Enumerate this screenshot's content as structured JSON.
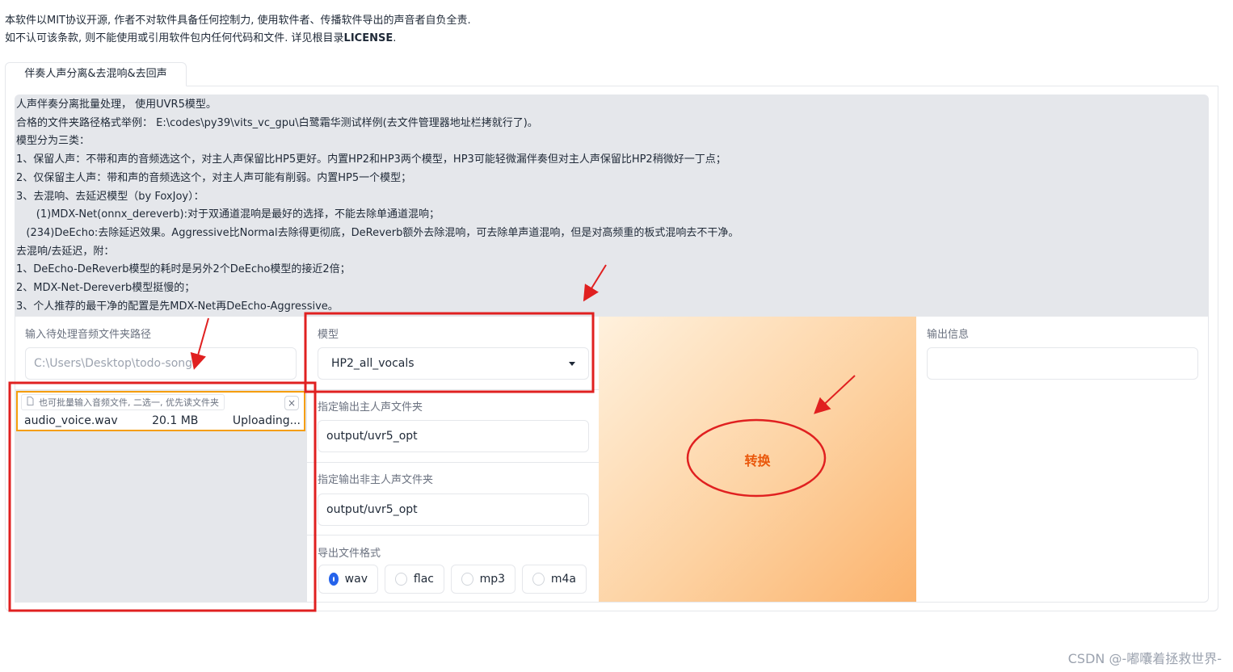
{
  "notice": {
    "line1": "本软件以MIT协议开源, 作者不对软件具备任何控制力, 使用软件者、传播软件导出的声音者自负全责.",
    "line2_prefix": "如不认可该条款, 则不能使用或引用软件包内任何代码和文件. 详见根目录",
    "line2_bold": "LICENSE",
    "line2_suffix": "."
  },
  "tab": {
    "label": "伴奏人声分离&去混响&去回声"
  },
  "description": [
    "人声伴奏分离批量处理， 使用UVR5模型。",
    "合格的文件夹路径格式举例： E:\\codes\\py39\\vits_vc_gpu\\白鹭霜华测试样例(去文件管理器地址栏拷就行了)。",
    "模型分为三类：",
    "1、保留人声：不带和声的音频选这个，对主人声保留比HP5更好。内置HP2和HP3两个模型，HP3可能轻微漏伴奏但对主人声保留比HP2稍微好一丁点；",
    "2、仅保留主人声：带和声的音频选这个，对主人声可能有削弱。内置HP5一个模型；",
    "3、去混响、去延迟模型（by FoxJoy）：",
    "      (1)MDX-Net(onnx_dereverb):对于双通道混响是最好的选择，不能去除单通道混响；",
    "   (234)DeEcho:去除延迟效果。Aggressive比Normal去除得更彻底，DeReverb额外去除混响，可去除单声道混响，但是对高频重的板式混响去不干净。",
    "去混响/去延迟，附：",
    "1、DeEcho-DeReverb模型的耗时是另外2个DeEcho模型的接近2倍；",
    "2、MDX-Net-Dereverb模型挺慢的；",
    "3、个人推荐的最干净的配置是先MDX-Net再DeEcho-Aggressive。"
  ],
  "input_folder": {
    "label": "输入待处理音频文件夹路径",
    "placeholder": "C:\\Users\\Desktop\\todo-songs"
  },
  "upload": {
    "label": "也可批量输入音频文件, 二选一, 优先读文件夹",
    "close": "×",
    "file_name": "audio_voice.wav",
    "file_size": "20.1 MB",
    "status": "Uploading..."
  },
  "model": {
    "label": "模型",
    "value": "HP2_all_vocals"
  },
  "vocal_output": {
    "label": "指定输出主人声文件夹",
    "value": "output/uvr5_opt"
  },
  "instrumental_output": {
    "label": "指定输出非主人声文件夹",
    "value": "output/uvr5_opt"
  },
  "export_format": {
    "label": "导出文件格式",
    "options": [
      "wav",
      "flac",
      "mp3",
      "m4a"
    ],
    "selected": "wav"
  },
  "convert_button": {
    "label": "转换"
  },
  "output_info": {
    "label": "输出信息",
    "value": ""
  },
  "watermark": "CSDN @-嘟囔着拯救世界-",
  "colors": {
    "annotation_red": "#e02020",
    "accent_orange": "#ea580c",
    "radio_blue": "#2563eb"
  }
}
